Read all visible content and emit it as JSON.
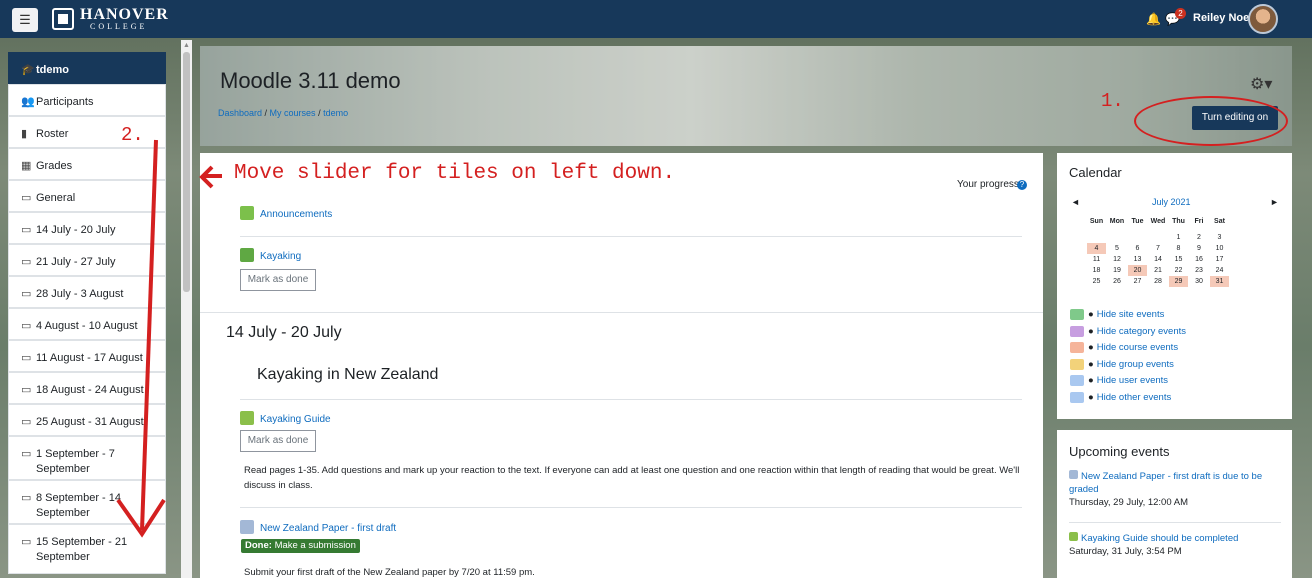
{
  "topbar": {
    "menu_icon": "hamburger-icon",
    "logo_text": "HANOVER",
    "logo_sub": "COLLEGE",
    "notification_icon": "bell-icon",
    "message_icon": "chat-icon",
    "message_count": "2",
    "user_name": "Reiley Noe"
  },
  "drawer": {
    "items": [
      {
        "icon": "graduation-cap-icon",
        "glyph": "🎓",
        "label": "tdemo"
      },
      {
        "icon": "users-icon",
        "glyph": "👥",
        "label": "Participants"
      },
      {
        "icon": "roster-icon",
        "glyph": "▮",
        "label": "Roster"
      },
      {
        "icon": "table-icon",
        "glyph": "▦",
        "label": "Grades"
      },
      {
        "icon": "folder-icon",
        "glyph": "▭",
        "label": "General"
      },
      {
        "icon": "folder-icon",
        "glyph": "▭",
        "label": "14 July - 20 July"
      },
      {
        "icon": "folder-icon",
        "glyph": "▭",
        "label": "21 July - 27 July"
      },
      {
        "icon": "folder-icon",
        "glyph": "▭",
        "label": "28 July - 3 August"
      },
      {
        "icon": "folder-icon",
        "glyph": "▭",
        "label": "4 August - 10 August"
      },
      {
        "icon": "folder-icon",
        "glyph": "▭",
        "label": "11 August - 17 August"
      },
      {
        "icon": "folder-icon",
        "glyph": "▭",
        "label": "18 August - 24 August"
      },
      {
        "icon": "folder-icon",
        "glyph": "▭",
        "label": "25 August - 31 August"
      },
      {
        "icon": "folder-icon",
        "glyph": "▭",
        "label": "1 September - 7 September"
      },
      {
        "icon": "folder-icon",
        "glyph": "▭",
        "label": "8 September - 14 September"
      },
      {
        "icon": "folder-icon",
        "glyph": "▭",
        "label": "15 September - 21 September"
      }
    ]
  },
  "header": {
    "course_title": "Moodle 3.11 demo",
    "breadcrumb": [
      "Dashboard",
      "My courses",
      "tdemo"
    ],
    "breadcrumb_sep": " / ",
    "gear_icon": "gear-icon",
    "edit_button": "Turn editing on"
  },
  "annotations": {
    "step1": "1.",
    "step2": "2.",
    "slider_note": "Move slider for tiles on left down."
  },
  "main": {
    "progress_label": "Your progress",
    "activities": {
      "announcements": "Announcements",
      "kayaking": "Kayaking",
      "kayaking_guide": "Kayaking Guide",
      "nz_paper": "New Zealand Paper - first draft"
    },
    "mark_as_done": "Mark as done",
    "section_title": "14 July - 20 July",
    "section_subtitle": "Kayaking in New Zealand",
    "guide_description": "Read pages 1-35. Add questions and mark up your reaction to the text. If everyone can add at least one question and one reaction within that length of reading that would be great. We'll discuss in class.",
    "done_prefix": "Done:",
    "done_text": "Make a submission",
    "paper_description": "Submit your first draft of the New Zealand paper by 7/20 at 11:59 pm."
  },
  "calendar": {
    "title": "Calendar",
    "month": "July 2021",
    "prev": "◄",
    "next": "►",
    "dow": [
      "Sun",
      "Mon",
      "Tue",
      "Wed",
      "Thu",
      "Fri",
      "Sat"
    ],
    "weeks": [
      [
        "",
        "",
        "",
        "",
        "1",
        "2",
        "3"
      ],
      [
        "4",
        "5",
        "6",
        "7",
        "8",
        "9",
        "10"
      ],
      [
        "11",
        "12",
        "13",
        "14",
        "15",
        "16",
        "17"
      ],
      [
        "18",
        "19",
        "20",
        "21",
        "22",
        "23",
        "24"
      ],
      [
        "25",
        "26",
        "27",
        "28",
        "29",
        "30",
        "31"
      ]
    ],
    "highlighted_days": [
      "4",
      "20",
      "29",
      "31"
    ],
    "event_toggles": [
      {
        "label": "Hide site events",
        "icon": "globe-icon",
        "color": "#7fc98a"
      },
      {
        "label": "Hide category events",
        "icon": "category-icon",
        "color": "#c79ee0"
      },
      {
        "label": "Hide course events",
        "icon": "graduation-cap-icon",
        "color": "#f5b49a"
      },
      {
        "label": "Hide group events",
        "icon": "users-icon",
        "color": "#f2d27a"
      },
      {
        "label": "Hide user events",
        "icon": "user-icon",
        "color": "#a9c8f0"
      },
      {
        "label": "Hide other events",
        "icon": "calendar-icon",
        "color": "#a9c8f0"
      }
    ]
  },
  "upcoming": {
    "title": "Upcoming events",
    "items": [
      {
        "title": "New Zealand Paper - first draft is due to be graded",
        "date": "Thursday, 29 July, 12:00 AM"
      },
      {
        "title": "Kayaking Guide should be completed",
        "date": "Saturday, 31 July, 3:54 PM"
      }
    ]
  },
  "colors": {
    "navbar": "#17385a",
    "link": "#0f6cbf",
    "annotation_red": "#d42020",
    "done_green": "#357a32"
  }
}
